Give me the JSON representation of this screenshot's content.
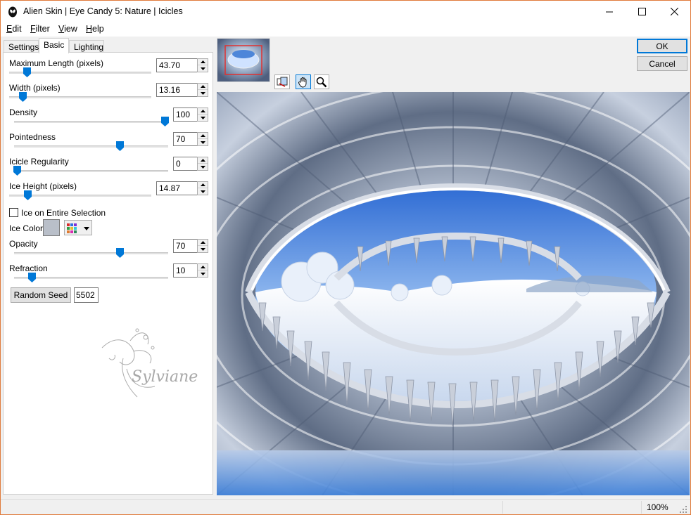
{
  "window": {
    "title": "Alien Skin | Eye Candy 5: Nature | Icicles",
    "controls": {
      "minimize": "—",
      "maximize": "☐",
      "close": "✕"
    }
  },
  "menu": [
    {
      "label": "Edit",
      "mnemonic": "E",
      "rest": "dit"
    },
    {
      "label": "Filter",
      "mnemonic": "F",
      "rest": "ilter"
    },
    {
      "label": "View",
      "mnemonic": "V",
      "rest": "iew"
    },
    {
      "label": "Help",
      "mnemonic": "H",
      "rest": "elp"
    }
  ],
  "tabs": [
    "Settings",
    "Basic",
    "Lighting"
  ],
  "active_tab": "Basic",
  "params": {
    "max_length": {
      "label": "Maximum Length (pixels)",
      "value": "43.70",
      "slider": 0.1
    },
    "width": {
      "label": "Width (pixels)",
      "value": "13.16",
      "slider": 0.05
    },
    "density": {
      "label": "Density",
      "value": "100",
      "slider": 1.0
    },
    "pointedness": {
      "label": "Pointedness",
      "value": "70",
      "slider": 0.7
    },
    "regularity": {
      "label": "Icicle Regularity",
      "value": "0",
      "slider": 0.0
    },
    "ice_height": {
      "label": "Ice Height (pixels)",
      "value": "14.87",
      "slider": 0.05
    },
    "ice_entire": {
      "label": "Ice on Entire Selection",
      "checked": false
    },
    "ice_color": {
      "label": "Ice Color",
      "color": "#b9bfc9"
    },
    "opacity": {
      "label": "Opacity",
      "value": "70",
      "slider": 0.7
    },
    "refraction": {
      "label": "Refraction",
      "value": "10",
      "slider": 0.1
    }
  },
  "seed": {
    "button": "Random Seed",
    "value": "5502"
  },
  "watermark_text": "Sylviane",
  "buttons": {
    "ok": "OK",
    "cancel": "Cancel"
  },
  "status": {
    "zoom": "100%"
  },
  "colors": {
    "accent": "#0078d7",
    "window_border": "#e07a3a"
  }
}
